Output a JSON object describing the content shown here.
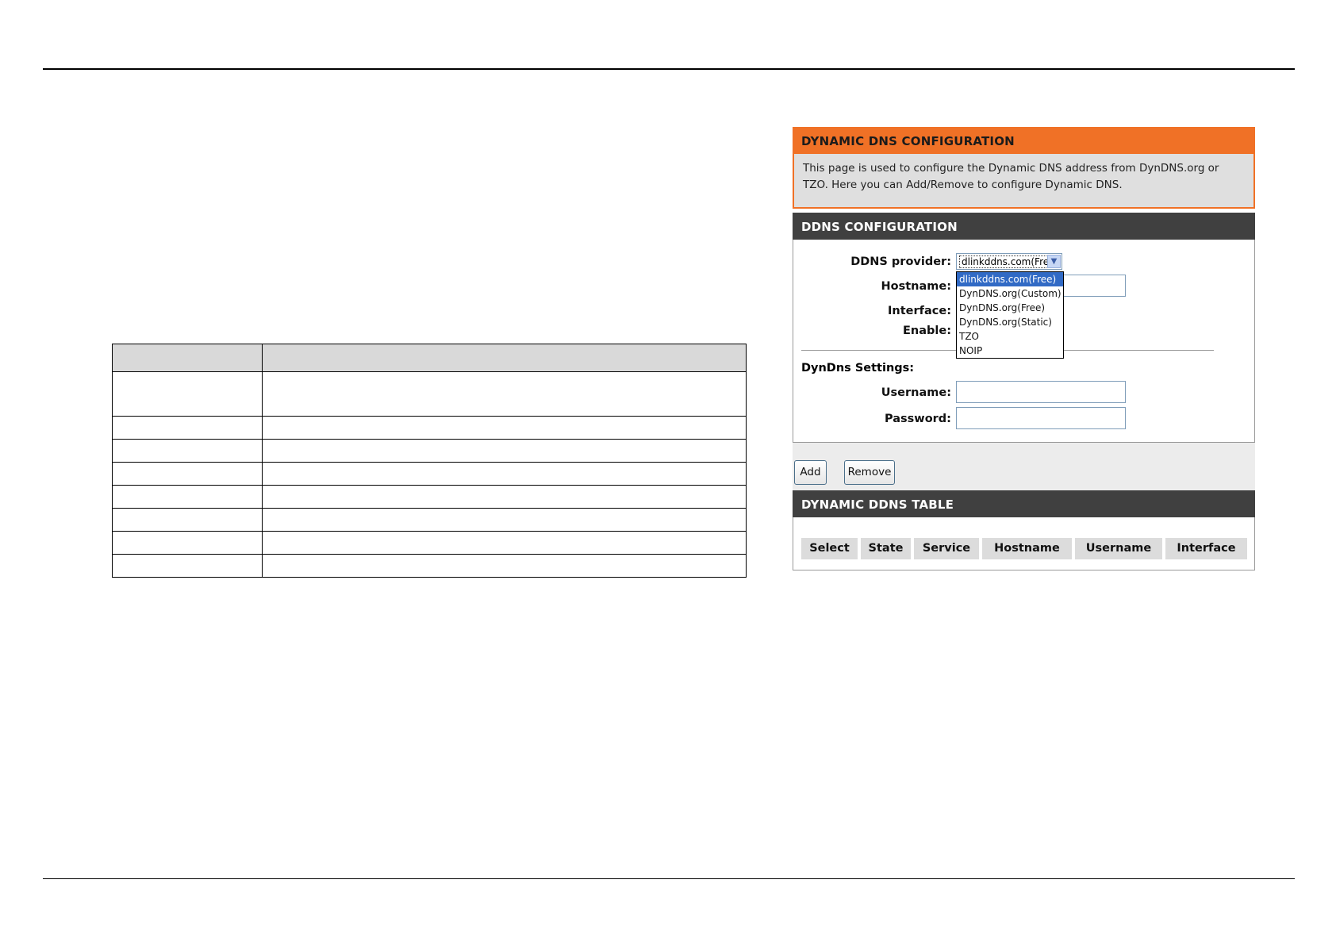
{
  "panel": {
    "title": "DYNAMIC DNS CONFIGURATION",
    "intro": "This page is used to configure the Dynamic DNS address from DynDNS.org or TZO. Here you can Add/Remove to configure Dynamic DNS.",
    "config_title": "DDNS CONFIGURATION",
    "table_title": "DYNAMIC DDNS TABLE"
  },
  "form": {
    "provider_label": "DDNS provider:",
    "provider_value": "dlinkddns.com(Free)",
    "provider_options": [
      "dlinkddns.com(Free)",
      "DynDNS.org(Custom)",
      "DynDNS.org(Free)",
      "DynDNS.org(Static)",
      "TZO",
      "NOIP"
    ],
    "hostname_label": "Hostname:",
    "interface_label": "Interface:",
    "enable_label": "Enable:",
    "dyndns_settings_label": "DynDns Settings:",
    "username_label": "Username:",
    "password_label": "Password:",
    "hostname_value": "",
    "username_value": "",
    "password_value": ""
  },
  "buttons": {
    "add": "Add",
    "remove": "Remove"
  },
  "table": {
    "headers": [
      "Select",
      "State",
      "Service",
      "Hostname",
      "Username",
      "Interface"
    ]
  }
}
